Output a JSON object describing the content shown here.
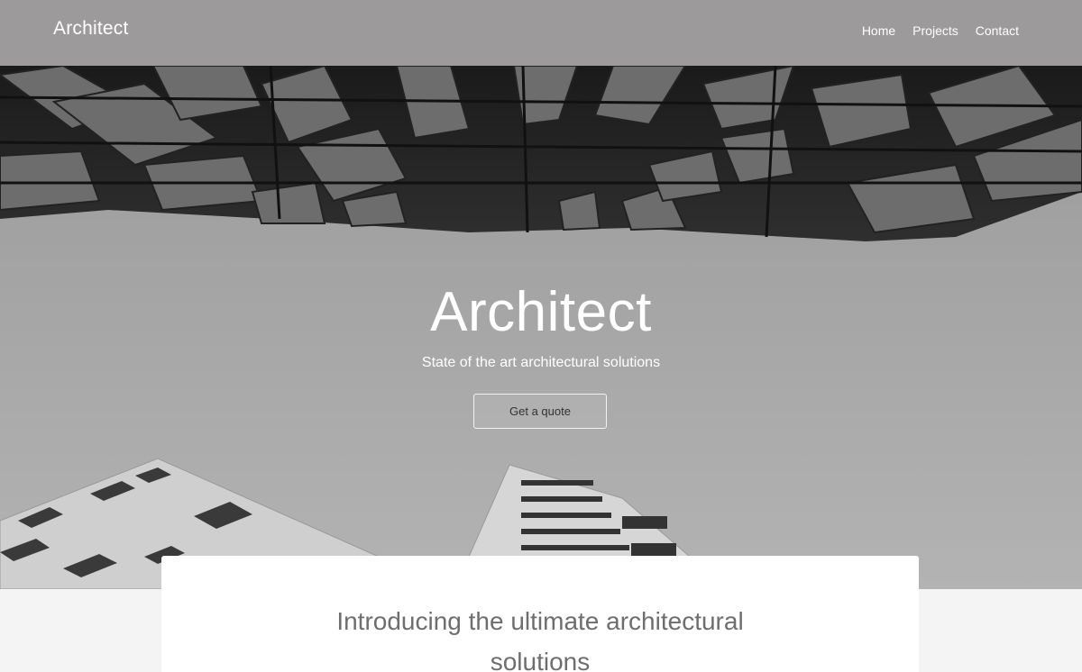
{
  "header": {
    "brand": "Architect",
    "nav": [
      {
        "label": "Home"
      },
      {
        "label": "Projects"
      },
      {
        "label": "Contact"
      }
    ]
  },
  "hero": {
    "title": "Architect",
    "subtitle": "State of the art architectural solutions",
    "cta_label": "Get a quote"
  },
  "intro": {
    "title": "Introducing the ultimate architectural solutions"
  },
  "colors": {
    "header_bg": "#9d9a9b",
    "hero_sky": "#a8a8a8",
    "page_bg": "#f4f4f4",
    "card_bg": "#ffffff"
  }
}
